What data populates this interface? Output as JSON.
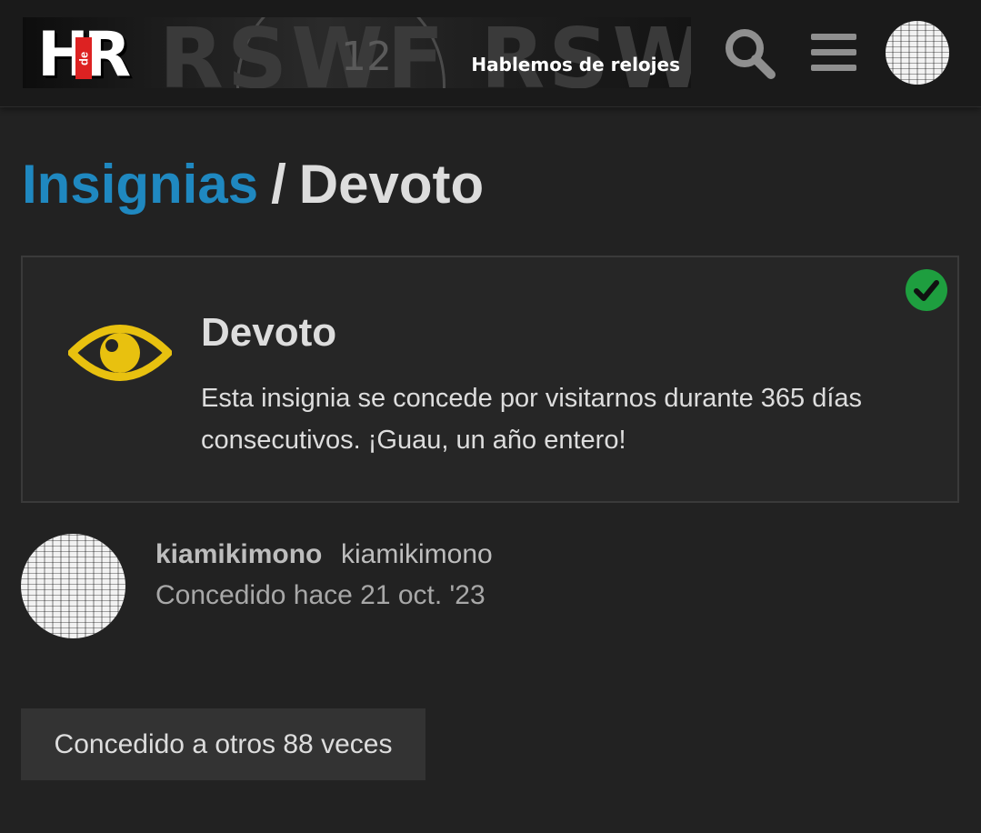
{
  "header": {
    "logo_text": "HR",
    "logo_de": "de",
    "logo_tagline": "Hablemos de relojes",
    "logo_bg_text": "RSWF RSWF",
    "logo_dial_number": "12",
    "icons": [
      "search-icon",
      "hamburger-menu-icon"
    ],
    "avatar": "user-avatar"
  },
  "breadcrumb": {
    "parent": "Insignias",
    "separator": "/",
    "current": "Devoto"
  },
  "badge": {
    "icon": "eye-icon",
    "icon_color": "#e8c10f",
    "title": "Devoto",
    "description": "Esta insignia se concede por visitarnos durante 365 días consecutivos. ¡Guau, un año entero!",
    "granted_icon": "check-circle-icon",
    "granted_color": "#1e9e3f"
  },
  "grant": {
    "username": "kiamikimono",
    "name": "kiamikimono",
    "date_text": "Concedido hace 21 oct. '23"
  },
  "others_button": {
    "label": "Concedido a otros 88 veces"
  },
  "colors": {
    "background": "#222222",
    "header": "#1a1a1a",
    "link": "#1f88c0",
    "text": "#dddddd"
  }
}
